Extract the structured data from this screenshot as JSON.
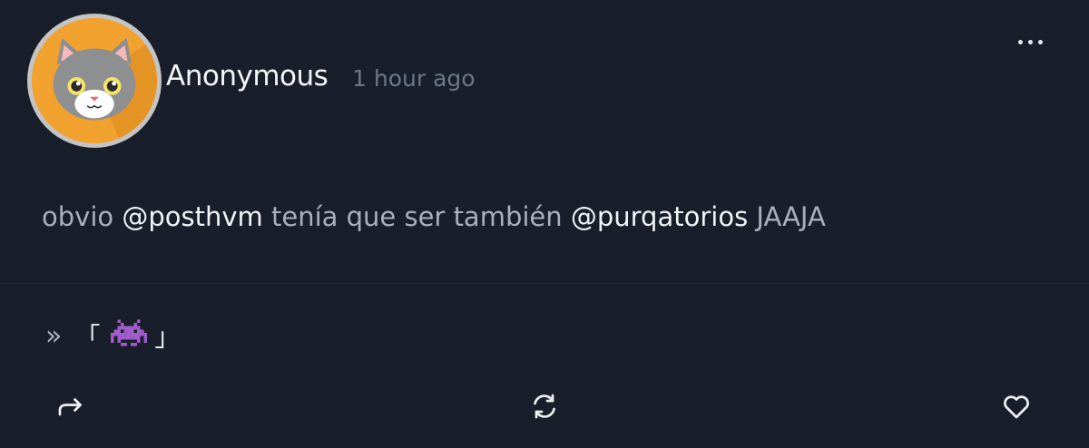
{
  "post": {
    "author": "Anonymous",
    "timestamp": "1 hour ago",
    "text": {
      "prefix": "obvio ",
      "mention1": "@posthvm",
      "middle": " tenía que ser también ",
      "mention2": "@purqatorios",
      "suffix": " JAAJA"
    },
    "footer": {
      "chevron": "»",
      "open_bracket": "「",
      "emoji_name": "alien-monster-icon",
      "close_bracket": "」"
    }
  },
  "actions": {
    "share": "share-icon",
    "repost": "repost-icon",
    "like": "heart-icon",
    "more": "more-icon"
  },
  "colors": {
    "background": "#181f2a",
    "avatar_bg": "#f0a12e",
    "timestamp": "#6c7787",
    "mention": "#f1f3f6"
  }
}
